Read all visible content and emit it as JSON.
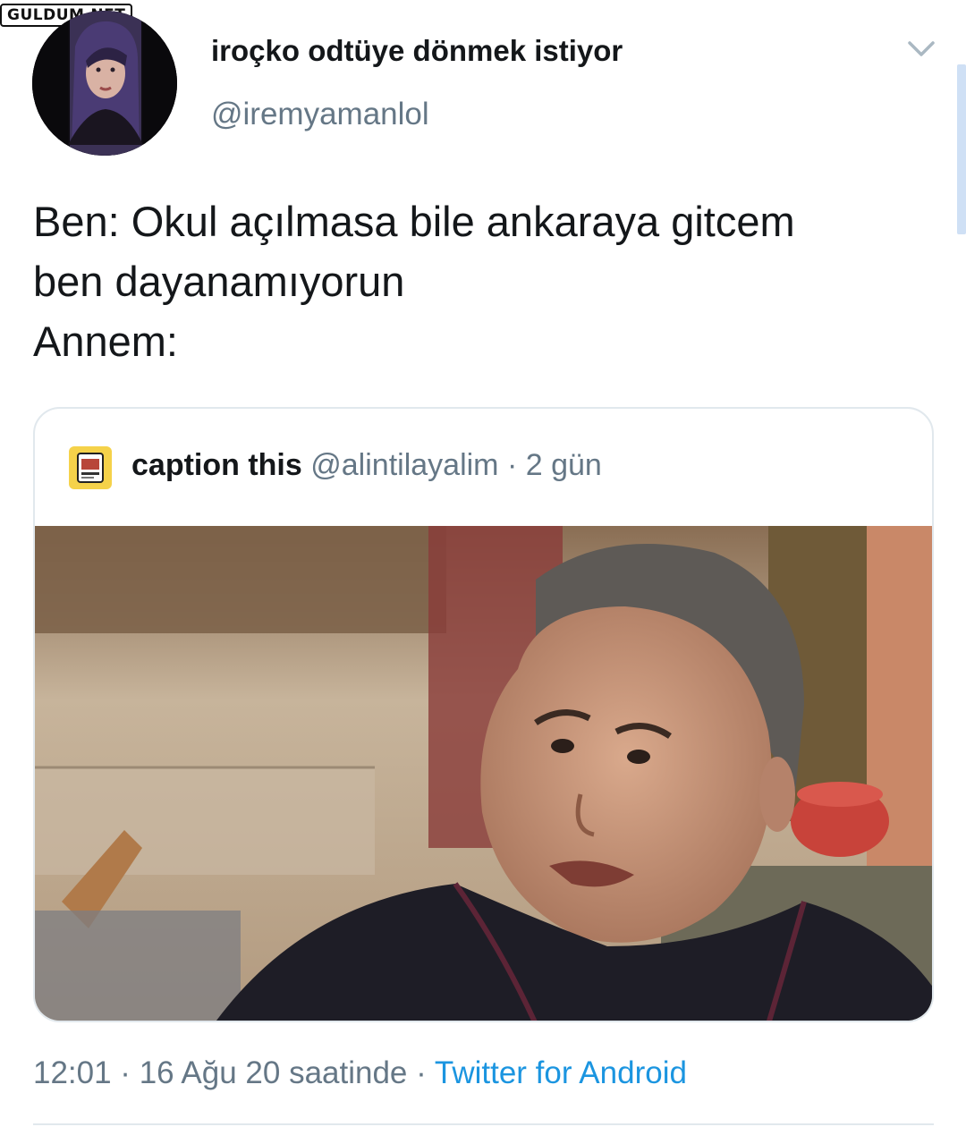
{
  "watermark": {
    "text": "GULDUM.NET"
  },
  "tweet": {
    "author": {
      "display_name": "iroçko odtüye dönmek istiyor",
      "handle": "@iremyamanlol"
    },
    "text_lines": [
      "Ben: Okul açılmasa bile ankaraya gitcem",
      "ben dayanamıyorun",
      "Annem:"
    ],
    "menu_icon": "chevron-down-icon",
    "timestamp": "12:01 · 16 Ağu 20 saatinde · ",
    "source": "Twitter for Android"
  },
  "quoted_tweet": {
    "display_name": "caption this",
    "meta": "@alintilayalim · 2 gün"
  },
  "colors": {
    "text_primary": "#14171a",
    "text_secondary": "#657786",
    "link": "#1b95e0",
    "border": "#e1e8ed"
  }
}
